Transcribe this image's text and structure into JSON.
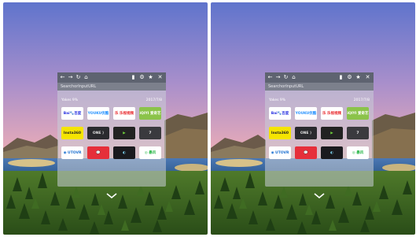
{
  "view": {
    "mode": "stereo-vr",
    "colors": {
      "sky_top": "#6a7ed0",
      "sky_mid": "#c9a2c6",
      "horizon": "#f0c490",
      "grass": "#2e5c1c",
      "panel": "#5e6370"
    }
  },
  "browser": {
    "toolbar": {
      "back_icon": "back-arrow-icon",
      "forward_icon": "forward-arrow-icon",
      "reload_icon": "reload-icon",
      "home_icon": "home-icon",
      "bookmark_icon": "bookmark-icon",
      "settings_icon": "settings-icon",
      "favorite_icon": "star-icon",
      "close_icon": "close-icon"
    },
    "url_placeholder": "SearchorInputURL",
    "date_left": "Yakes 9%",
    "date_right": "2017/7/8",
    "tiles": [
      {
        "label": "Bai🐾百度",
        "icon": "baidu-logo",
        "bg": "#ffffff",
        "fg": "#2932e1"
      },
      {
        "label": "YOUKU优酷",
        "icon": "youku-logo",
        "bg": "#ffffff",
        "fg": "#1f8fff"
      },
      {
        "label": "乐 乐视视频",
        "icon": "letv-logo",
        "bg": "#ffffff",
        "fg": "#e8262a"
      },
      {
        "label": "iQIYI 爱奇艺",
        "icon": "iqiyi-logo",
        "bg": "#8bc34a",
        "fg": "#ffffff"
      },
      {
        "label": "Insta360",
        "icon": "insta360-logo",
        "bg": "#f5e400",
        "fg": "#222222"
      },
      {
        "label": "ONE ⟩",
        "icon": "one-logo",
        "bg": "#2a2a2e",
        "fg": "#e0e0e0"
      },
      {
        "label": "▶",
        "icon": "green-play-logo",
        "bg": "#222222",
        "fg": "#6fd23a"
      },
      {
        "label": "7",
        "icon": "seven-logo",
        "bg": "#3a3a3e",
        "fg": "#f0f0f0"
      },
      {
        "label": "◉ UTOVR",
        "icon": "utovr-logo",
        "bg": "#ffffff",
        "fg": "#1a6fd0"
      },
      {
        "label": "💬",
        "icon": "chat-logo",
        "bg": "#e62f3a",
        "fg": "#ffffff"
      },
      {
        "label": "◐",
        "icon": "vr-swirl-logo",
        "bg": "#1a1a1e",
        "fg": "#7dd3f0"
      },
      {
        "label": "◎ 暴风",
        "icon": "storm-logo",
        "bg": "#ffffff",
        "fg": "#2db84b"
      }
    ],
    "more_icon": "chevron-down-icon"
  }
}
